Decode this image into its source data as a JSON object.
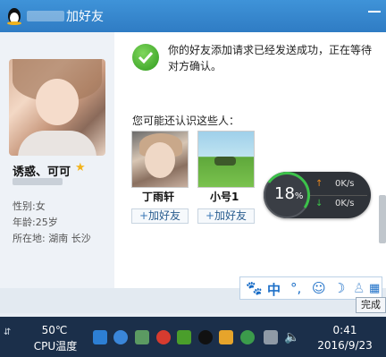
{
  "window": {
    "title": "加好友"
  },
  "profile": {
    "nickname": "诱惑、可可",
    "gender_label": "性别:",
    "gender": "女",
    "age_label": "年龄:",
    "age": "25岁",
    "location_label": "所在地:",
    "location": "湖南 长沙"
  },
  "message": {
    "success": "你的好友添加请求已经发送成功，正在等待对方确认。",
    "maybe_know": "您可能还认识这些人："
  },
  "suggestions": [
    {
      "name": "丁雨轩",
      "button": "加好友"
    },
    {
      "name": "小号1",
      "button": "加好友"
    }
  ],
  "speed_widget": {
    "percent": "18",
    "percent_unit": "%",
    "upload": "0K/s",
    "download": "0K/s"
  },
  "ime_bar": {
    "lang": "中"
  },
  "done_button": "完成",
  "taskbar": {
    "cpu_temp": "50℃",
    "cpu_label": "CPU温度",
    "time": "0:41",
    "date": "2016/9/23"
  },
  "colors": {
    "titlebar": "#2f7cc4",
    "taskbar": "#1b2f4a",
    "success_green": "#2f9b1d"
  }
}
